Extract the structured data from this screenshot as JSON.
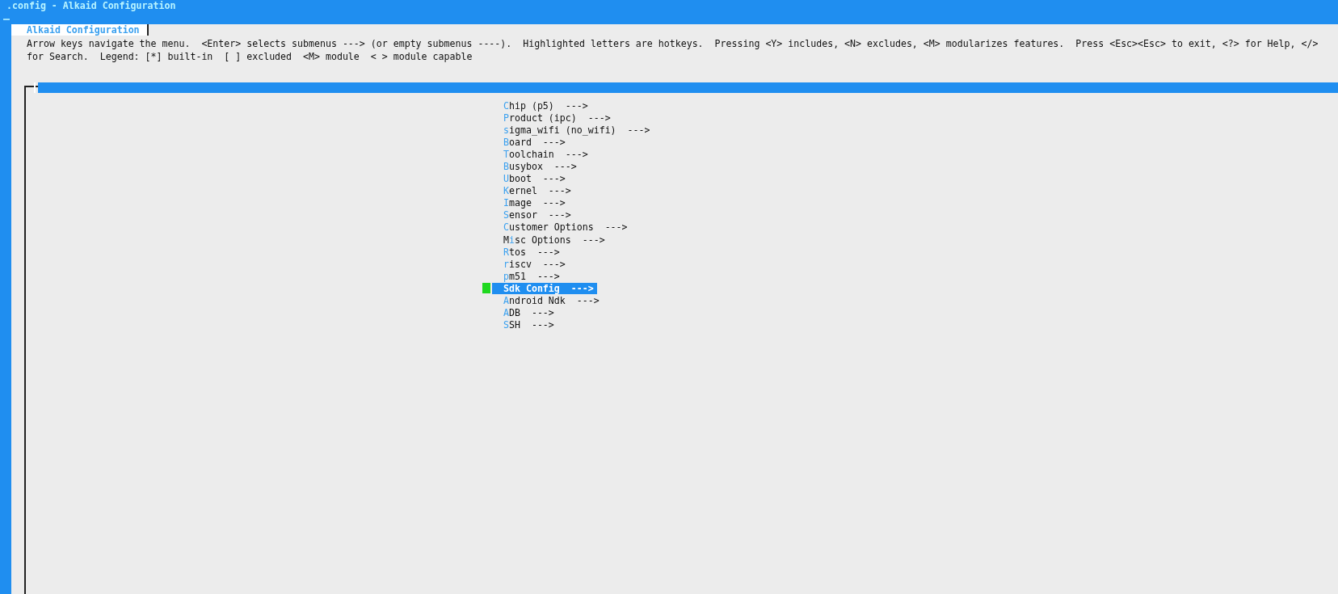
{
  "window": {
    "title": ".config - Alkaid Configuration"
  },
  "dialog": {
    "title": "Alkaid Configuration",
    "help_lines": [
      "Arrow keys navigate the menu.  <Enter> selects submenus ---> (or empty submenus ----).  Highlighted letters are hotkeys.  Pressing <Y> includes, <N> excludes, <M> modularizes features.  Press <Esc><Esc> to exit, <?> for Help, </>",
      "for Search.  Legend: [*] built-in  [ ] excluded  <M> module  < > module capable"
    ]
  },
  "menu": {
    "items": [
      {
        "key": "C",
        "post": "hip (p5)  --->",
        "selected": false
      },
      {
        "key": "P",
        "post": "roduct (ipc)  --->",
        "selected": false
      },
      {
        "key": "s",
        "post": "igma_wifi (no_wifi)  --->",
        "selected": false
      },
      {
        "key": "B",
        "post": "oard  --->",
        "selected": false
      },
      {
        "key": "T",
        "post": "oolchain  --->",
        "selected": false
      },
      {
        "key": "B",
        "post": "usybox  --->",
        "selected": false
      },
      {
        "key": "U",
        "post": "boot  --->",
        "selected": false
      },
      {
        "key": "K",
        "post": "ernel  --->",
        "selected": false
      },
      {
        "key": "I",
        "post": "mage  --->",
        "selected": false
      },
      {
        "key": "S",
        "post": "ensor  --->",
        "selected": false
      },
      {
        "key": "C",
        "post": "ustomer Options  --->",
        "selected": false
      },
      {
        "pre": "M",
        "key": "i",
        "post": "sc Options  --->",
        "selected": false
      },
      {
        "key": "R",
        "post": "tos  --->",
        "selected": false
      },
      {
        "key": "r",
        "post": "iscv  --->",
        "selected": false
      },
      {
        "key": "p",
        "post": "m51  --->",
        "selected": false
      },
      {
        "key": "S",
        "post": "dk Config  --->",
        "selected": true
      },
      {
        "key": "A",
        "post": "ndroid Ndk  --->",
        "selected": false
      },
      {
        "key": "A",
        "post": "DB  --->",
        "selected": false
      },
      {
        "key": "S",
        "post": "SH  --->",
        "selected": false
      }
    ]
  }
}
